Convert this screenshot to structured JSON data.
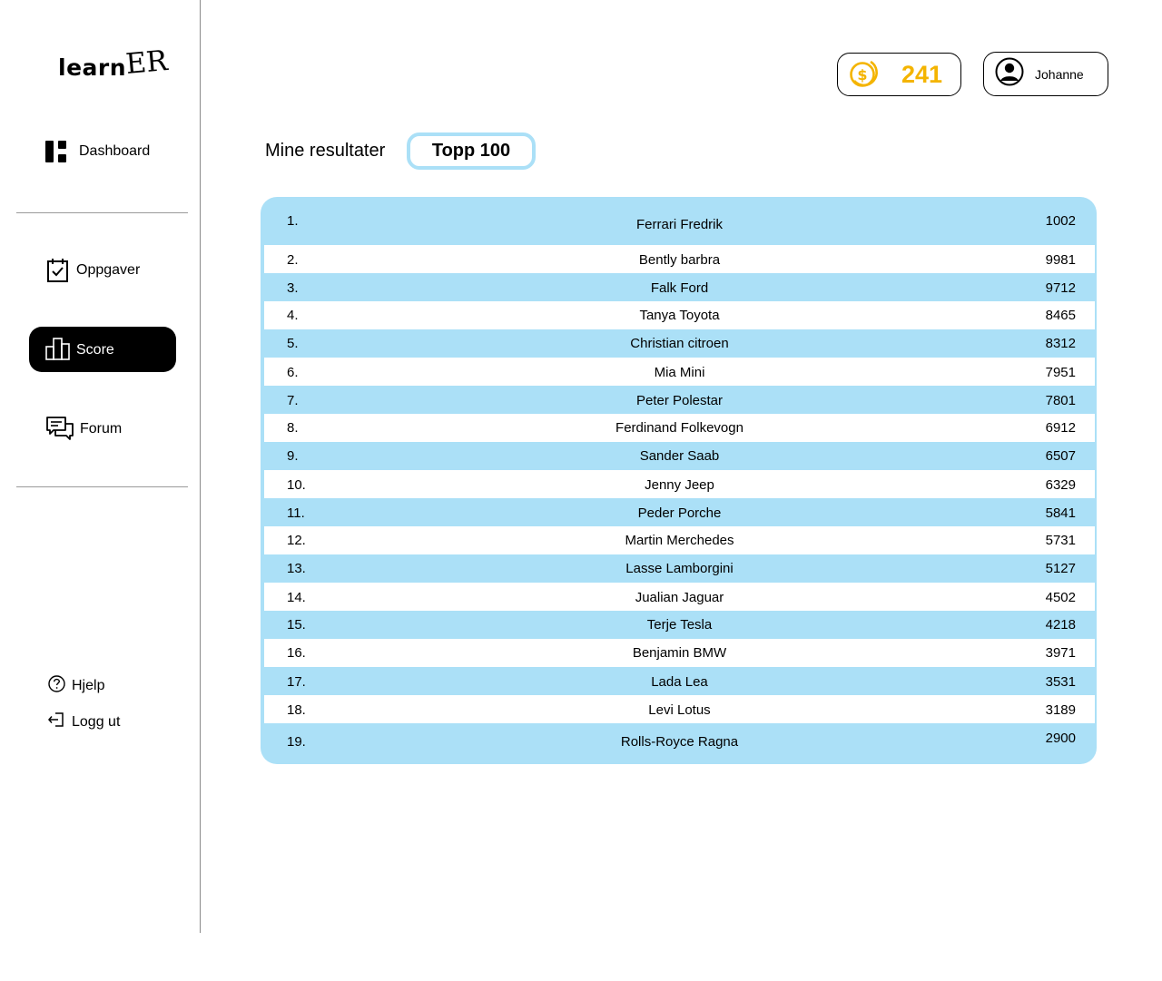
{
  "sidebar": {
    "logo": {
      "part1": "learn",
      "part2": "ER"
    },
    "nav": [
      {
        "label": "Dashboard",
        "icon": "dashboard-icon"
      },
      {
        "label": "Oppgaver",
        "icon": "clipboard-check-icon"
      },
      {
        "label": "Score",
        "icon": "bar-chart-icon",
        "active": true
      },
      {
        "label": "Forum",
        "icon": "chat-bubbles-icon"
      }
    ],
    "footer": [
      {
        "label": "Hjelp",
        "icon": "help-circle-icon"
      },
      {
        "label": "Logg ut",
        "icon": "logout-icon"
      }
    ]
  },
  "header": {
    "coins": "241",
    "coin_color": "#f4b400",
    "user_name": "Johanne"
  },
  "tabs": {
    "mine": "Mine resultater",
    "top": "Topp 100"
  },
  "colors": {
    "accent": "#abe0f7",
    "active_nav": "#000000"
  },
  "leaderboard": [
    {
      "rank": "1.",
      "name": "Ferrari Fredrik",
      "points": "1002"
    },
    {
      "rank": "2.",
      "name": "Bently barbra",
      "points": "9981"
    },
    {
      "rank": "3.",
      "name": "Falk Ford",
      "points": "9712"
    },
    {
      "rank": "4.",
      "name": "Tanya Toyota",
      "points": "8465"
    },
    {
      "rank": "5.",
      "name": "Christian citroen",
      "points": "8312"
    },
    {
      "rank": "6.",
      "name": "Mia Mini",
      "points": "7951"
    },
    {
      "rank": "7.",
      "name": "Peter Polestar",
      "points": "7801"
    },
    {
      "rank": "8.",
      "name": "Ferdinand Folkevogn",
      "points": "6912"
    },
    {
      "rank": "9.",
      "name": "Sander Saab",
      "points": "6507"
    },
    {
      "rank": "10.",
      "name": "Jenny Jeep",
      "points": "6329"
    },
    {
      "rank": "11.",
      "name": "Peder Porche",
      "points": "5841"
    },
    {
      "rank": "12.",
      "name": "Martin Merchedes",
      "points": "5731"
    },
    {
      "rank": "13.",
      "name": "Lasse Lamborgini",
      "points": "5127"
    },
    {
      "rank": "14.",
      "name": "Jualian Jaguar",
      "points": "4502"
    },
    {
      "rank": "15.",
      "name": "Terje Tesla",
      "points": "4218"
    },
    {
      "rank": "16.",
      "name": "Benjamin BMW",
      "points": "3971"
    },
    {
      "rank": "17.",
      "name": "Lada Lea",
      "points": "3531"
    },
    {
      "rank": "18.",
      "name": "Levi Lotus",
      "points": "3189"
    },
    {
      "rank": "19.",
      "name": "Rolls-Royce Ragna",
      "points": "2900"
    }
  ]
}
